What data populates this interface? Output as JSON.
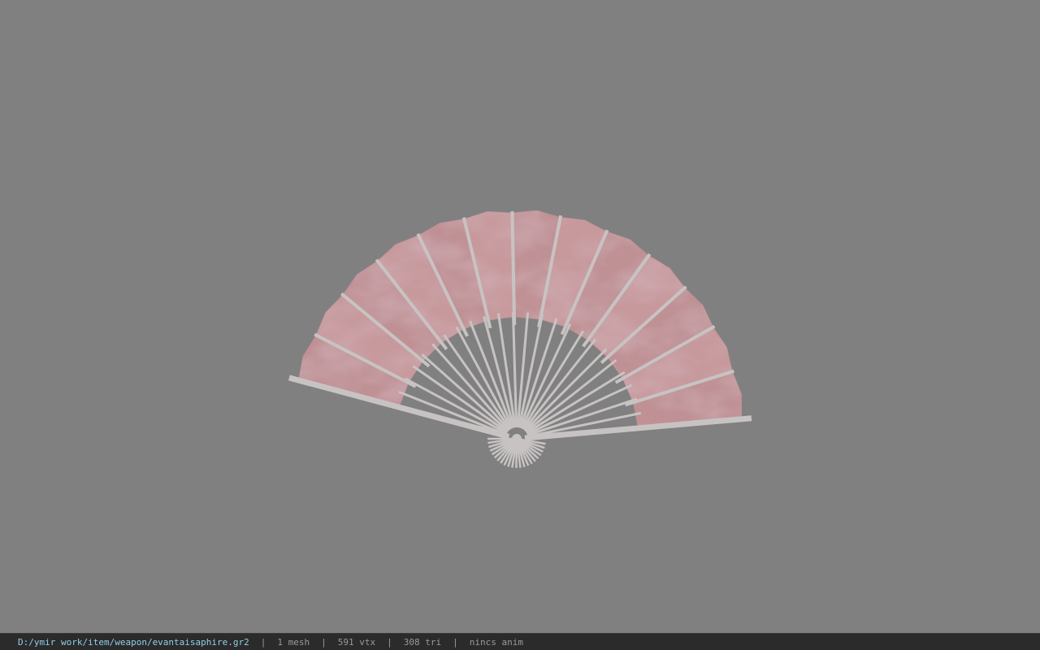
{
  "viewer": {
    "background_color": "#808080",
    "model": "folding-fan",
    "rib_color": "#c8c3c3",
    "leaf_color": "#c7999c"
  },
  "statusbar": {
    "file_path": "D:/ymir work/item/weapon/evantaisaphire.gr2",
    "separator": "|",
    "mesh_count": "1 mesh",
    "vertex_count": "591 vtx",
    "triangle_count": "308 tri",
    "animation": "nincs anim"
  }
}
